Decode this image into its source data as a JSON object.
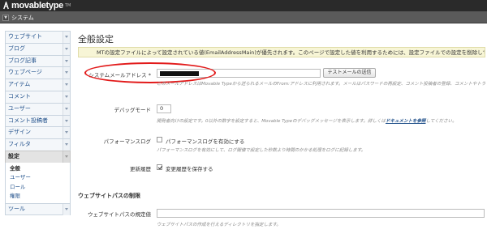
{
  "header": {
    "brand": "movabletype",
    "brand_tm": "TM"
  },
  "scope": {
    "label": "システム"
  },
  "sidebar": {
    "items": [
      {
        "label": "ウェブサイト"
      },
      {
        "label": "ブログ"
      },
      {
        "label": "ブログ記事"
      },
      {
        "label": "ウェブページ"
      },
      {
        "label": "アイテム"
      },
      {
        "label": "コメント"
      },
      {
        "label": "ユーザー"
      },
      {
        "label": "コメント投稿者"
      },
      {
        "label": "デザイン"
      },
      {
        "label": "フィルタ"
      },
      {
        "label": "設定"
      }
    ],
    "sub_items": [
      {
        "label": "全般"
      },
      {
        "label": "ユーザー"
      },
      {
        "label": "ロール"
      },
      {
        "label": "権限"
      }
    ],
    "tools": {
      "label": "ツール"
    }
  },
  "main": {
    "title": "全般設定",
    "notice": "MTの設定ファイルによって設定されている値(EmailAddressMain)が優先されます。このページで設定した値を利用するためには、設定ファイルでの設定を削除してください。",
    "email": {
      "label": "システムメールアドレス *",
      "test_button": "テストメールの送信",
      "hint": "このメールアドレスはMovable Typeから送られるメールのFrom:アドレスに利用されます。メールはパスワードの再設定、コメント投稿者の登録、コメントやトラックバックの通知に送信されます。"
    },
    "debug": {
      "label": "デバッグモード",
      "value": "0",
      "hint_pre": "開発者向けの設定です。0以外の数字を設定すると、Movable Typeのデバッグメッセージを表示します。詳しくは",
      "hint_link": "ドキュメントを参照",
      "hint_post": "してください。"
    },
    "performance": {
      "label": "パフォーマンスログ",
      "checkbox_label": "パフォーマンスログを有効にする",
      "hint": "パフォーマンスログを有効にして、ログ閾値で設定した秒数より時間のかかる処理をログに記録します。"
    },
    "history": {
      "label": "更新履歴",
      "checkbox_label": "変更履歴を保存する"
    },
    "website_path": {
      "section_title": "ウェブサイトパスの制限",
      "label": "ウェブサイトパスの規定値",
      "value": "",
      "hint": "ウェブサイトパスの作成を行えるディレクトリを指定します。"
    }
  },
  "colors": {
    "topbar": "#2a2a2a",
    "subbar": "#5a5a5a",
    "link": "#1f4f8a",
    "notice_bg": "#f7f5d6",
    "highlight": "#e21a1a"
  }
}
